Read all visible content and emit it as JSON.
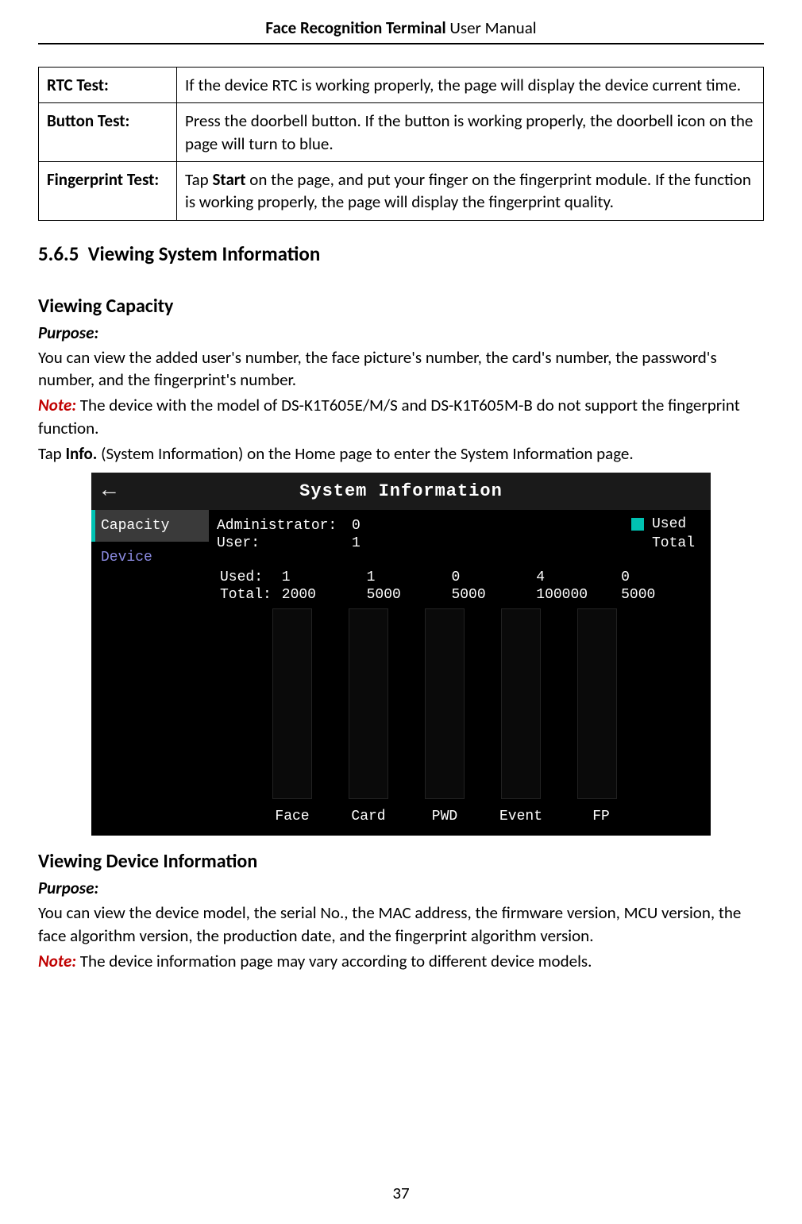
{
  "header": {
    "bold": "Face Recognition Terminal",
    "rest": " User Manual"
  },
  "tests": {
    "rows": [
      {
        "label": "RTC Test:",
        "desc": "If the device RTC is working properly, the page will display the device current time."
      },
      {
        "label": "Button Test:",
        "desc": "Press the doorbell button. If the button is working properly, the doorbell icon on the page will turn to blue."
      },
      {
        "label": "Fingerprint Test:",
        "desc_pre": "Tap ",
        "desc_strong": "Start",
        "desc_post": " on the page, and put your finger on the fingerprint module. If the function is working properly, the page will display the fingerprint quality."
      }
    ]
  },
  "section": {
    "num": "5.6.5",
    "title": "Viewing System Information"
  },
  "capacity": {
    "heading": "Viewing Capacity",
    "purpose_label": "Purpose:",
    "purpose_body": "You can view the added user's number, the face picture's number, the card's number, the password's number, and the fingerprint's number.",
    "note_lead": "Note:",
    "note_body": " The device with the model of DS-K1T605E/M/S and DS-K1T605M-B do not support the fingerprint function.",
    "instr_pre": "Tap ",
    "instr_strong": "Info.",
    "instr_post": " (System Information) on the Home page to enter the System Information page."
  },
  "screenshot": {
    "title": "System Information",
    "tabs": {
      "capacity": "Capacity",
      "device": "Device"
    },
    "kv": {
      "admin_label": "Administrator:",
      "admin_val": "0",
      "user_label": "User:",
      "user_val": "1"
    },
    "legend": {
      "used": "Used",
      "total": "Total"
    },
    "table": {
      "used_label": "Used:",
      "total_label": "Total:",
      "used": [
        "1",
        "1",
        "0",
        "4",
        "0"
      ],
      "total": [
        "2000",
        "5000",
        "5000",
        "100000",
        "5000"
      ]
    },
    "categories": [
      "Face",
      "Card",
      "PWD",
      "Event",
      "FP"
    ]
  },
  "chart_data": {
    "type": "bar",
    "categories": [
      "Face",
      "Card",
      "PWD",
      "Event",
      "FP"
    ],
    "series": [
      {
        "name": "Used",
        "values": [
          1,
          1,
          0,
          4,
          0
        ]
      },
      {
        "name": "Total",
        "values": [
          2000,
          5000,
          5000,
          100000,
          5000
        ]
      }
    ],
    "title": "System Information — Capacity",
    "xlabel": "",
    "ylabel": ""
  },
  "device_info": {
    "heading": "Viewing Device Information",
    "purpose_label": "Purpose:",
    "purpose_body": "You can view the device model, the serial No., the MAC address, the firmware version, MCU version, the face algorithm version, the production date, and the fingerprint algorithm version.",
    "note_lead": "Note:",
    "note_body": " The device information page may vary according to different device models."
  },
  "page_number": "37"
}
